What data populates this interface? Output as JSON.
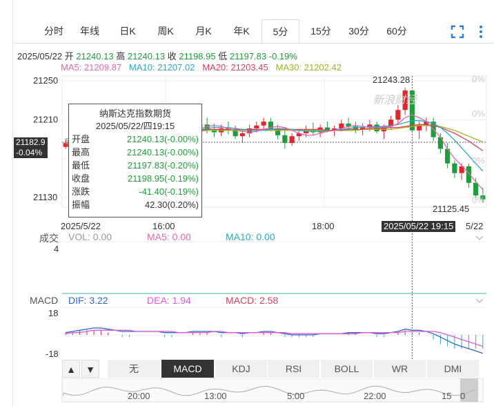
{
  "tabs": [
    "分时",
    "年线",
    "日K",
    "周K",
    "月K",
    "年K",
    "5分",
    "15分",
    "30分",
    "60分"
  ],
  "active_tab": "5分",
  "ohlc_line": {
    "date": "2025/05/22",
    "open_label": "开",
    "open": "21240.13",
    "high_label": "高",
    "high": "21240.13",
    "close_label": "收",
    "close": "21198.95",
    "low_label": "低",
    "low": "21197.83",
    "change": "-0.19%"
  },
  "ma_line": {
    "ma5": "MA5: 21209.87",
    "ma10": "MA10: 21207.02",
    "ma20": "MA20: 21203.45",
    "ma30": "MA30: 21202.42"
  },
  "colors": {
    "ma5": "#e667a8",
    "ma10": "#2ba7c7",
    "ma20": "#d9425a",
    "ma30": "#a1b31e",
    "up": "#e0262e",
    "down": "#1e9e3a",
    "dif": "#2f64c9",
    "dea": "#e259d8"
  },
  "y_ticks": [
    "21250",
    "21210",
    "21130"
  ],
  "pct_ticks": [
    "0%",
    "0%",
    "0%",
    "0%"
  ],
  "crosshair_price": "21182.9",
  "crosshair_pct": "-0.04%",
  "high_label": "21243.28",
  "low_label": "21125.45",
  "watermark": "新浪财经",
  "x_labels": [
    "2025/5/22",
    "16:00",
    "18:00",
    "5/22"
  ],
  "crosshair_time": "2025/05/22 19:15",
  "tooltip": {
    "title": "纳斯达克指数期货",
    "time": "2025/05/22/四19:15",
    "rows": [
      {
        "k": "开盘",
        "v": "21240.13(-0.00%)",
        "c": "green"
      },
      {
        "k": "最高",
        "v": "21240.13(-0.00%)",
        "c": "green"
      },
      {
        "k": "最低",
        "v": "21197.83(-0.20%)",
        "c": "green"
      },
      {
        "k": "收盘",
        "v": "21198.95(-0.19%)",
        "c": "green"
      },
      {
        "k": "涨跌",
        "v": "-41.40(-0.19%)",
        "c": "green"
      },
      {
        "k": "振幅",
        "v": "42.30(0.20%)",
        "c": "black"
      }
    ]
  },
  "volume": {
    "label": "成交",
    "vol": "VOL: 0.00",
    "ma5": "MA5: 0.00",
    "ma10": "MA10: 0.00",
    "tick": "4"
  },
  "macd": {
    "label": "MACD",
    "dif": "DIF: 3.22",
    "dea": "DEA: 1.94",
    "macd": "MACD: 2.58",
    "top": "18",
    "bottom": "-18"
  },
  "indicator_tabs": [
    "无",
    "MACD",
    "KDJ",
    "RSI",
    "BOLL",
    "WR",
    "DMI"
  ],
  "active_indicator": "MACD",
  "nav_labels": [
    "20:00",
    "13:00",
    "5:00",
    "22:00",
    "15",
    "0"
  ],
  "chart_data": {
    "type": "candlestick",
    "interval": "5分",
    "ylim": [
      21120,
      21255
    ],
    "candles": [
      [
        21182,
        21190,
        21180,
        21186
      ],
      [
        21186,
        21200,
        21183,
        21195
      ],
      [
        21195,
        21210,
        21190,
        21205
      ],
      [
        21205,
        21222,
        21200,
        21215
      ],
      [
        21215,
        21220,
        21196,
        21200
      ],
      [
        21200,
        21212,
        21195,
        21208
      ],
      [
        21208,
        21215,
        21198,
        21203
      ],
      [
        21203,
        21210,
        21188,
        21192
      ],
      [
        21192,
        21200,
        21185,
        21195
      ],
      [
        21195,
        21205,
        21192,
        21200
      ],
      [
        21200,
        21210,
        21196,
        21205
      ],
      [
        21205,
        21212,
        21196,
        21199
      ],
      [
        21199,
        21206,
        21192,
        21202
      ],
      [
        21202,
        21208,
        21196,
        21198
      ],
      [
        21198,
        21203,
        21188,
        21192
      ],
      [
        21192,
        21200,
        21188,
        21196
      ],
      [
        21196,
        21205,
        21192,
        21200
      ],
      [
        21200,
        21214,
        21198,
        21210
      ],
      [
        21210,
        21215,
        21200,
        21203
      ],
      [
        21203,
        21210,
        21197,
        21205
      ],
      [
        21205,
        21212,
        21196,
        21199
      ],
      [
        21199,
        21206,
        21192,
        21197
      ],
      [
        21197,
        21205,
        21193,
        21201
      ],
      [
        21201,
        21208,
        21195,
        21199
      ],
      [
        21199,
        21204,
        21190,
        21193
      ],
      [
        21193,
        21200,
        21186,
        21196
      ],
      [
        21196,
        21205,
        21192,
        21201
      ],
      [
        21201,
        21208,
        21197,
        21204
      ],
      [
        21204,
        21212,
        21200,
        21208
      ],
      [
        21208,
        21212,
        21198,
        21200
      ],
      [
        21200,
        21205,
        21190,
        21194
      ],
      [
        21194,
        21200,
        21180,
        21186
      ],
      [
        21186,
        21196,
        21183,
        21193
      ],
      [
        21193,
        21200,
        21188,
        21196
      ],
      [
        21196,
        21204,
        21192,
        21200
      ],
      [
        21200,
        21207,
        21194,
        21197
      ],
      [
        21197,
        21205,
        21192,
        21202
      ],
      [
        21202,
        21208,
        21197,
        21199
      ],
      [
        21199,
        21204,
        21193,
        21201
      ],
      [
        21201,
        21210,
        21198,
        21206
      ],
      [
        21206,
        21212,
        21200,
        21203
      ],
      [
        21203,
        21208,
        21196,
        21200
      ],
      [
        21200,
        21206,
        21194,
        21202
      ],
      [
        21202,
        21210,
        21198,
        21205
      ],
      [
        21205,
        21208,
        21196,
        21198
      ],
      [
        21198,
        21205,
        21190,
        21203
      ],
      [
        21203,
        21214,
        21200,
        21210
      ],
      [
        21210,
        21225,
        21205,
        21220
      ],
      [
        21220,
        21243,
        21215,
        21240
      ],
      [
        21240,
        21240,
        21197,
        21199
      ],
      [
        21199,
        21208,
        21190,
        21204
      ],
      [
        21204,
        21212,
        21198,
        21208
      ],
      [
        21208,
        21212,
        21188,
        21192
      ],
      [
        21192,
        21196,
        21175,
        21180
      ],
      [
        21180,
        21186,
        21160,
        21165
      ],
      [
        21165,
        21168,
        21150,
        21155
      ],
      [
        21155,
        21165,
        21148,
        21162
      ],
      [
        21162,
        21165,
        21140,
        21145
      ],
      [
        21145,
        21150,
        21128,
        21132
      ],
      [
        21132,
        21140,
        21125,
        21128
      ]
    ],
    "ma5": [
      21190,
      21192,
      21195,
      21198,
      21201,
      21203,
      21204,
      21204,
      21202,
      21200,
      21199,
      21199,
      21200,
      21200,
      21199,
      21197,
      21196,
      21197,
      21199,
      21201,
      21203,
      21204,
      21203,
      21201,
      21199,
      21198,
      21197,
      21198,
      21200,
      21202,
      21203,
      21202,
      21199,
      21196,
      21194,
      21194,
      21196,
      21198,
      21199,
      21201,
      21203,
      21204,
      21203,
      21202,
      21202,
      21202,
      21203,
      21206,
      21212,
      21215,
      21212,
      21208,
      21200,
      21192,
      21180,
      21170,
      21163,
      21155,
      21146,
      21138
    ],
    "ma10": [
      21188,
      21189,
      21190,
      21192,
      21195,
      21197,
      21199,
      21200,
      21201,
      21201,
      21201,
      21200,
      21200,
      21200,
      21199,
      21199,
      21198,
      21198,
      21199,
      21200,
      21201,
      21202,
      21202,
      21202,
      21201,
      21200,
      21199,
      21199,
      21199,
      21200,
      21201,
      21201,
      21200,
      21199,
      21198,
      21198,
      21198,
      21198,
      21199,
      21200,
      21201,
      21202,
      21202,
      21203,
      21203,
      21203,
      21204,
      21205,
      21207,
      21209,
      21209,
      21208,
      21206,
      21202,
      21196,
      21189,
      21181,
      21173,
      21165,
      21157
    ],
    "ma20": [
      21186,
      21187,
      21188,
      21189,
      21191,
      21192,
      21193,
      21194,
      21195,
      21196,
      21197,
      21197,
      21198,
      21198,
      21199,
      21199,
      21199,
      21199,
      21199,
      21199,
      21200,
      21200,
      21200,
      21200,
      21200,
      21200,
      21200,
      21200,
      21200,
      21200,
      21200,
      21200,
      21200,
      21200,
      21200,
      21200,
      21200,
      21199,
      21199,
      21199,
      21200,
      21200,
      21200,
      21201,
      21201,
      21201,
      21202,
      21202,
      21203,
      21204,
      21205,
      21205,
      21204,
      21202,
      21199,
      21196,
      21192,
      21188,
      21183,
      21178
    ],
    "ma30": [
      21185,
      21186,
      21187,
      21188,
      21189,
      21190,
      21191,
      21192,
      21193,
      21194,
      21195,
      21195,
      21196,
      21196,
      21197,
      21197,
      21198,
      21198,
      21198,
      21198,
      21199,
      21199,
      21199,
      21199,
      21199,
      21199,
      21199,
      21199,
      21199,
      21199,
      21199,
      21199,
      21199,
      21199,
      21199,
      21199,
      21199,
      21199,
      21199,
      21199,
      21199,
      21199,
      21200,
      21200,
      21200,
      21200,
      21200,
      21201,
      21202,
      21203,
      21204,
      21204,
      21204,
      21203,
      21201,
      21199,
      21196,
      21193,
      21190,
      21187
    ],
    "macd_ylim": [
      -18,
      18
    ],
    "dif": [
      2,
      3,
      4,
      5,
      6,
      6,
      5,
      4,
      3,
      3,
      3,
      3,
      3,
      3,
      2,
      2,
      2,
      2,
      3,
      3,
      3,
      3,
      2,
      2,
      2,
      1,
      2,
      2,
      3,
      3,
      2,
      1,
      0,
      0,
      0,
      0,
      1,
      1,
      1,
      1,
      2,
      2,
      2,
      2,
      1,
      1,
      2,
      3,
      5,
      4,
      4,
      3,
      1,
      -2,
      -5,
      -8,
      -10,
      -12,
      -14,
      -16
    ],
    "dea": [
      1,
      2,
      2,
      3,
      4,
      4,
      4,
      4,
      4,
      4,
      3,
      3,
      3,
      3,
      3,
      3,
      2,
      2,
      2,
      2,
      2,
      3,
      3,
      2,
      2,
      2,
      2,
      2,
      2,
      2,
      2,
      2,
      1,
      1,
      1,
      1,
      1,
      1,
      1,
      1,
      1,
      1,
      2,
      2,
      2,
      2,
      2,
      2,
      3,
      3,
      3,
      3,
      3,
      2,
      0,
      -2,
      -4,
      -6,
      -8,
      -10
    ],
    "macd": [
      2,
      2,
      4,
      4,
      4,
      4,
      2,
      0,
      -2,
      -2,
      0,
      0,
      0,
      0,
      -2,
      -2,
      0,
      0,
      2,
      2,
      2,
      0,
      -2,
      0,
      0,
      -2,
      0,
      0,
      2,
      2,
      0,
      -2,
      -2,
      -2,
      -2,
      -2,
      0,
      0,
      0,
      0,
      2,
      2,
      0,
      0,
      -2,
      -2,
      0,
      2,
      4,
      2,
      2,
      0,
      -4,
      -8,
      -10,
      -12,
      -12,
      -12,
      -12,
      -12
    ]
  }
}
